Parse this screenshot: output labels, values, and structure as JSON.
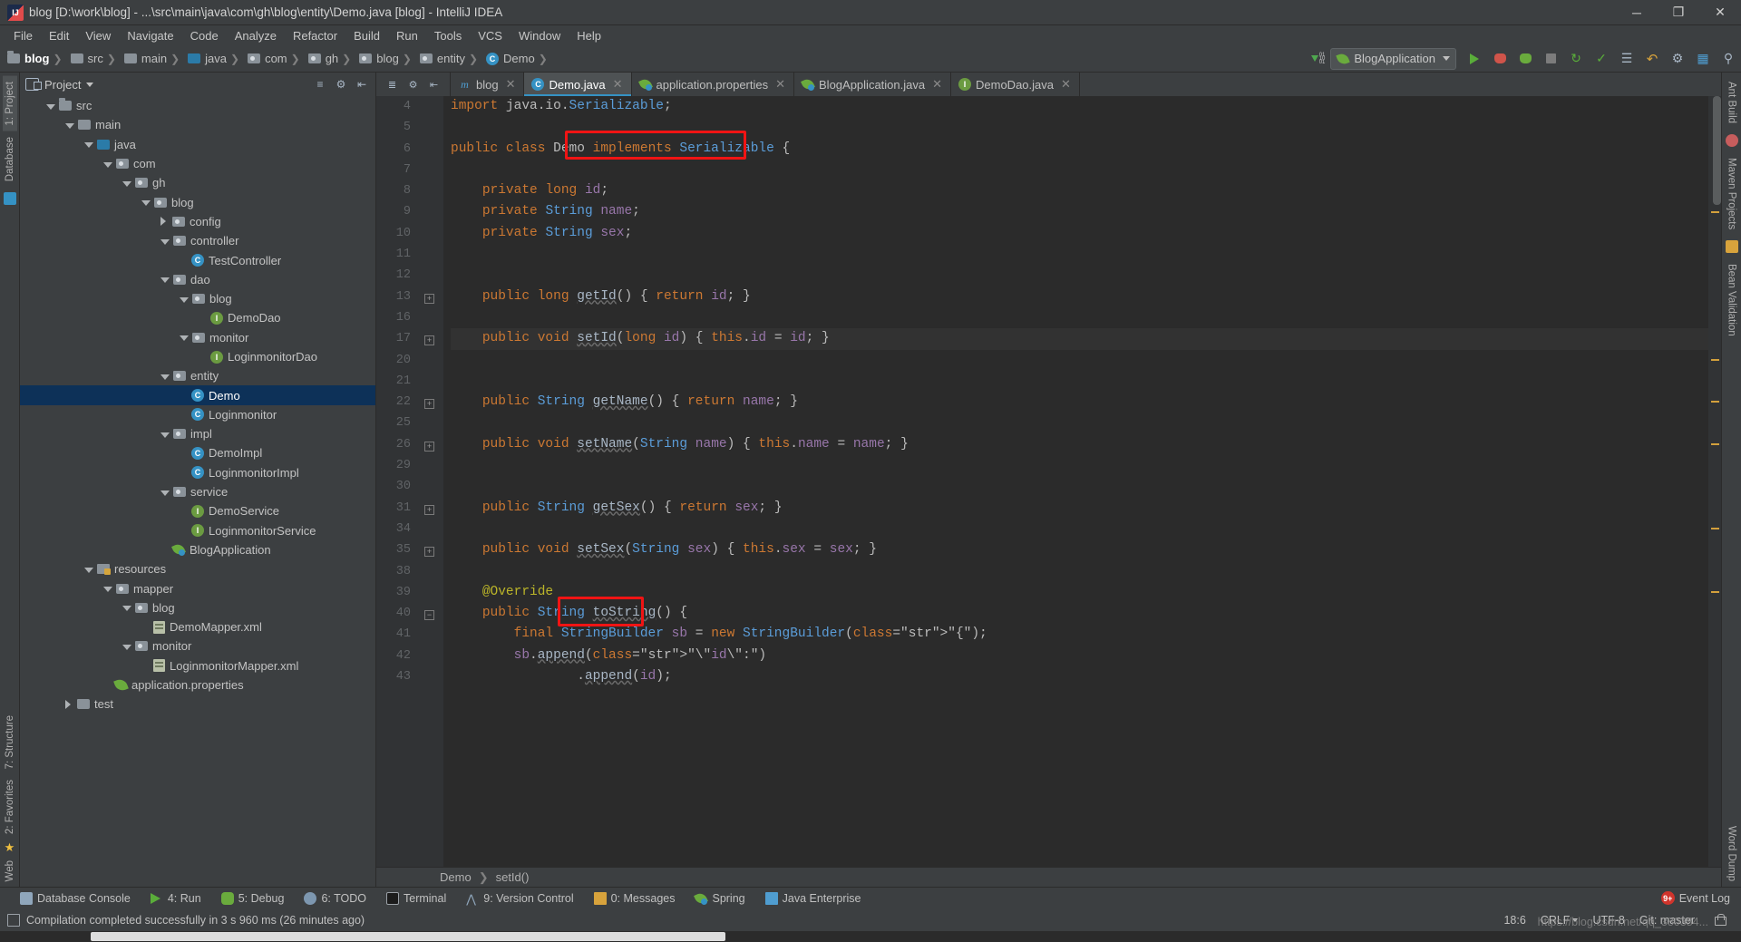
{
  "window": {
    "title": "blog [D:\\work\\blog] - ...\\src\\main\\java\\com\\gh\\blog\\entity\\Demo.java [blog] - IntelliJ IDEA",
    "minimize": "─",
    "maximize": "❐",
    "close": "✕"
  },
  "menubar": [
    "File",
    "Edit",
    "View",
    "Navigate",
    "Code",
    "Analyze",
    "Refactor",
    "Build",
    "Run",
    "Tools",
    "VCS",
    "Window",
    "Help"
  ],
  "breadcrumb": [
    {
      "label": "blog",
      "icon": "folder-module-icon"
    },
    {
      "label": "src",
      "icon": "folder-source-icon"
    },
    {
      "label": "main",
      "icon": "folder-icon"
    },
    {
      "label": "java",
      "icon": "folder-java-icon"
    },
    {
      "label": "com",
      "icon": "folder-package-icon"
    },
    {
      "label": "gh",
      "icon": "folder-package-icon"
    },
    {
      "label": "blog",
      "icon": "folder-package-icon"
    },
    {
      "label": "entity",
      "icon": "folder-package-icon"
    },
    {
      "label": "Demo",
      "icon": "class-icon"
    }
  ],
  "toolbar": {
    "run_config": "BlogApplication",
    "buttons": [
      "run-button",
      "debug-button",
      "run-coverage-button",
      "stop-button",
      "update-button",
      "commit-button",
      "rollback-button",
      "settings-button",
      "search-button"
    ]
  },
  "left_bar": [
    "1: Project",
    "Database"
  ],
  "left_bar_bottom": [
    "7: Structure",
    "2: Favorites"
  ],
  "left_bar_web": "Web",
  "right_bar": [
    "Ant Build",
    "Maven Projects",
    "Bean Validation"
  ],
  "right_bar_bottom": "Word Dump",
  "project": {
    "title": "Project",
    "tree": [
      {
        "label": "src",
        "indent": 1,
        "twisty": "down",
        "icon": "folder-source"
      },
      {
        "label": "main",
        "indent": 2,
        "twisty": "down",
        "icon": "folder"
      },
      {
        "label": "java",
        "indent": 3,
        "twisty": "down",
        "icon": "folder-java"
      },
      {
        "label": "com",
        "indent": 4,
        "twisty": "down",
        "icon": "folder-package"
      },
      {
        "label": "gh",
        "indent": 5,
        "twisty": "down",
        "icon": "folder-package"
      },
      {
        "label": "blog",
        "indent": 6,
        "twisty": "down",
        "icon": "folder-package"
      },
      {
        "label": "config",
        "indent": 7,
        "twisty": "right",
        "icon": "folder-package"
      },
      {
        "label": "controller",
        "indent": 7,
        "twisty": "down",
        "icon": "folder-package"
      },
      {
        "label": "TestController",
        "indent": 8,
        "twisty": "none",
        "icon": "class"
      },
      {
        "label": "dao",
        "indent": 7,
        "twisty": "down",
        "icon": "folder-package"
      },
      {
        "label": "blog",
        "indent": 8,
        "twisty": "down",
        "icon": "folder-package"
      },
      {
        "label": "DemoDao",
        "indent": 9,
        "twisty": "none",
        "icon": "interface"
      },
      {
        "label": "monitor",
        "indent": 8,
        "twisty": "down",
        "icon": "folder-package"
      },
      {
        "label": "LoginmonitorDao",
        "indent": 9,
        "twisty": "none",
        "icon": "interface"
      },
      {
        "label": "entity",
        "indent": 7,
        "twisty": "down",
        "icon": "folder-package"
      },
      {
        "label": "Demo",
        "indent": 8,
        "twisty": "none",
        "icon": "class",
        "selected": true
      },
      {
        "label": "Loginmonitor",
        "indent": 8,
        "twisty": "none",
        "icon": "class"
      },
      {
        "label": "impl",
        "indent": 7,
        "twisty": "down",
        "icon": "folder-package"
      },
      {
        "label": "DemoImpl",
        "indent": 8,
        "twisty": "none",
        "icon": "class"
      },
      {
        "label": "LoginmonitorImpl",
        "indent": 8,
        "twisty": "none",
        "icon": "class"
      },
      {
        "label": "service",
        "indent": 7,
        "twisty": "down",
        "icon": "folder-package"
      },
      {
        "label": "DemoService",
        "indent": 8,
        "twisty": "none",
        "icon": "interface"
      },
      {
        "label": "LoginmonitorService",
        "indent": 8,
        "twisty": "none",
        "icon": "interface"
      },
      {
        "label": "BlogApplication",
        "indent": 7,
        "twisty": "none",
        "icon": "spring-class"
      },
      {
        "label": "resources",
        "indent": 3,
        "twisty": "down",
        "icon": "folder-resources"
      },
      {
        "label": "mapper",
        "indent": 4,
        "twisty": "down",
        "icon": "folder-package"
      },
      {
        "label": "blog",
        "indent": 5,
        "twisty": "down",
        "icon": "folder-package"
      },
      {
        "label": "DemoMapper.xml",
        "indent": 6,
        "twisty": "none",
        "icon": "xml"
      },
      {
        "label": "monitor",
        "indent": 5,
        "twisty": "down",
        "icon": "folder-package"
      },
      {
        "label": "LoginmonitorMapper.xml",
        "indent": 6,
        "twisty": "none",
        "icon": "xml"
      },
      {
        "label": "application.properties",
        "indent": 4,
        "twisty": "none",
        "icon": "properties"
      },
      {
        "label": "test",
        "indent": 2,
        "twisty": "right",
        "icon": "folder"
      }
    ]
  },
  "tabs": [
    {
      "label": "blog",
      "icon": "module-icon",
      "active": false,
      "closable": true
    },
    {
      "label": "Demo.java",
      "icon": "class-icon",
      "active": true,
      "closable": true
    },
    {
      "label": "application.properties",
      "icon": "properties-icon",
      "active": false,
      "closable": true
    },
    {
      "label": "BlogApplication.java",
      "icon": "spring-class-icon",
      "active": false,
      "closable": true
    },
    {
      "label": "DemoDao.java",
      "icon": "interface-icon",
      "active": false,
      "closable": true
    }
  ],
  "editor": {
    "line_numbers": [
      "4",
      "5",
      "6",
      "7",
      "8",
      "9",
      "10",
      "11",
      "12",
      "13",
      "16",
      "17",
      "20",
      "21",
      "22",
      "25",
      "26",
      "29",
      "30",
      "31",
      "34",
      "35",
      "38",
      "39",
      "40",
      "41",
      "42",
      "43"
    ],
    "lines": [
      {
        "num": "4",
        "text": "import java.io.Serializable;"
      },
      {
        "num": "5",
        "text": ""
      },
      {
        "num": "6",
        "text": "public class Demo implements Serializable {"
      },
      {
        "num": "7",
        "text": ""
      },
      {
        "num": "8",
        "text": "    private long id;"
      },
      {
        "num": "9",
        "text": "    private String name;"
      },
      {
        "num": "10",
        "text": "    private String sex;"
      },
      {
        "num": "11",
        "text": ""
      },
      {
        "num": "12",
        "text": ""
      },
      {
        "num": "13",
        "text": "    public long getId() { return id; }"
      },
      {
        "num": "16",
        "text": ""
      },
      {
        "num": "17",
        "text": "    public void setId(long id) { this.id = id; }"
      },
      {
        "num": "20",
        "text": ""
      },
      {
        "num": "21",
        "text": ""
      },
      {
        "num": "22",
        "text": "    public String getName() { return name; }"
      },
      {
        "num": "25",
        "text": ""
      },
      {
        "num": "26",
        "text": "    public void setName(String name) { this.name = name; }"
      },
      {
        "num": "29",
        "text": ""
      },
      {
        "num": "30",
        "text": ""
      },
      {
        "num": "31",
        "text": "    public String getSex() { return sex; }"
      },
      {
        "num": "34",
        "text": ""
      },
      {
        "num": "35",
        "text": "    public void setSex(String sex) { this.sex = sex; }"
      },
      {
        "num": "38",
        "text": ""
      },
      {
        "num": "39",
        "text": "    @Override"
      },
      {
        "num": "40",
        "text": "    public String toString() {"
      },
      {
        "num": "41",
        "text": "        final StringBuilder sb = new StringBuilder(\"{\");"
      },
      {
        "num": "42",
        "text": "        sb.append(\"\\\"id\\\":\")"
      },
      {
        "num": "43",
        "text": "                .append(id);"
      }
    ],
    "highlight_boxes": [
      {
        "name": "implements-serializable-highlight",
        "text": "implements Serializable"
      },
      {
        "name": "tostring-highlight",
        "text": "toString()"
      }
    ],
    "breadcrumb": [
      "Demo",
      "setId()"
    ]
  },
  "bottom_tools": [
    {
      "label": "Database Console",
      "icon": "database-icon",
      "mnemonic": ""
    },
    {
      "label": "4: Run",
      "icon": "run-icon",
      "mnemonic": "4"
    },
    {
      "label": "5: Debug",
      "icon": "debug-icon",
      "mnemonic": "5"
    },
    {
      "label": "6: TODO",
      "icon": "todo-icon",
      "mnemonic": "6"
    },
    {
      "label": "Terminal",
      "icon": "terminal-icon",
      "mnemonic": ""
    },
    {
      "label": "9: Version Control",
      "icon": "vcs-icon",
      "mnemonic": "9"
    },
    {
      "label": "0: Messages",
      "icon": "messages-icon",
      "mnemonic": "0"
    },
    {
      "label": "Spring",
      "icon": "spring-icon",
      "mnemonic": ""
    },
    {
      "label": "Java Enterprise",
      "icon": "java-enterprise-icon",
      "mnemonic": ""
    }
  ],
  "event_log": {
    "label": "Event Log",
    "badge": "9+"
  },
  "status": {
    "message": "Compilation completed successfully in 3 s 960 ms (26 minutes ago)",
    "caret": "18:6",
    "line_sep": "CRLF",
    "encoding": "UTF-8",
    "branch": "Git: master",
    "watermark": "https://blog.csdn.net/qq_380384..."
  },
  "colors": {
    "accent": "#3592c4",
    "highlight_red": "#f01414",
    "keyword": "#cc7832",
    "string": "#6a8759",
    "field": "#9876aa",
    "annotation": "#bbb529",
    "type": "#5b9dd9",
    "selection": "#0d3158",
    "bg_editor": "#2b2b2b",
    "bg_chrome": "#3c3f41"
  }
}
